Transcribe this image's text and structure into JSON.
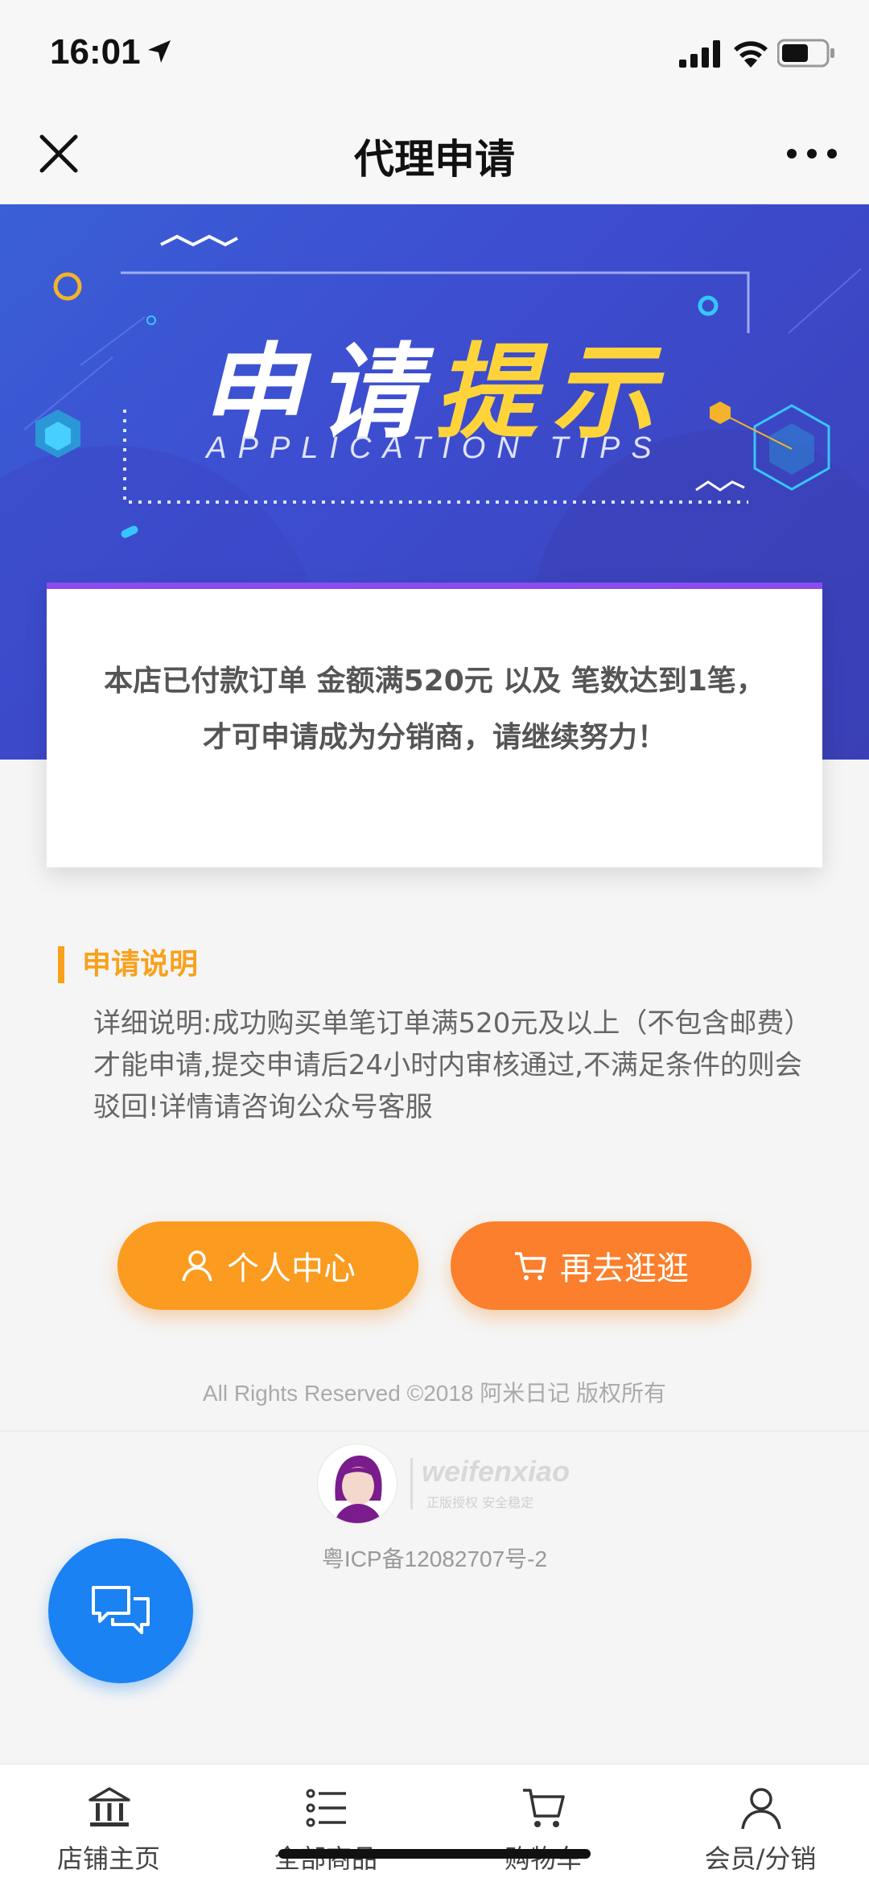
{
  "status_bar": {
    "time": "16:01"
  },
  "nav": {
    "title": "代理申请"
  },
  "banner": {
    "title_white": "申请",
    "title_yellow": "提示",
    "subtitle": "APPLICATION TIPS"
  },
  "notice": {
    "line1": "本店已付款订单 金额满520元 以及 笔数达到1笔，",
    "line2": "才可申请成为分销商，请继续努力！"
  },
  "section": {
    "title": "申请说明",
    "body": "详细说明:成功购买单笔订单满520元及以上（不包含邮费）才能申请,提交申请后24小时内审核通过,不满足条件的则会驳回!详情请咨询公众号客服"
  },
  "buttons": {
    "personal_center": "个人中心",
    "continue_shopping": "再去逛逛"
  },
  "footer": {
    "copyright": "All Rights Reserved ©2018 阿米日记 版权所有",
    "brand_name": "weifenxiao",
    "brand_tag": "正版授权 安全稳定",
    "icp": "粤ICP备12082707号-2"
  },
  "tabs": [
    {
      "label": "店铺主页",
      "icon": "store-icon"
    },
    {
      "label": "全部商品",
      "icon": "list-icon"
    },
    {
      "label": "购物车",
      "icon": "cart-icon"
    },
    {
      "label": "会员/分销",
      "icon": "user-icon"
    }
  ],
  "colors": {
    "accent_orange": "#fb9b1f",
    "accent_orange_dark": "#fb7f2c",
    "banner_blue": "#3d4ed0",
    "title_yellow": "#ffd43a",
    "card_top_purple": "#8a4cf0",
    "fab_blue": "#1a82f2"
  }
}
